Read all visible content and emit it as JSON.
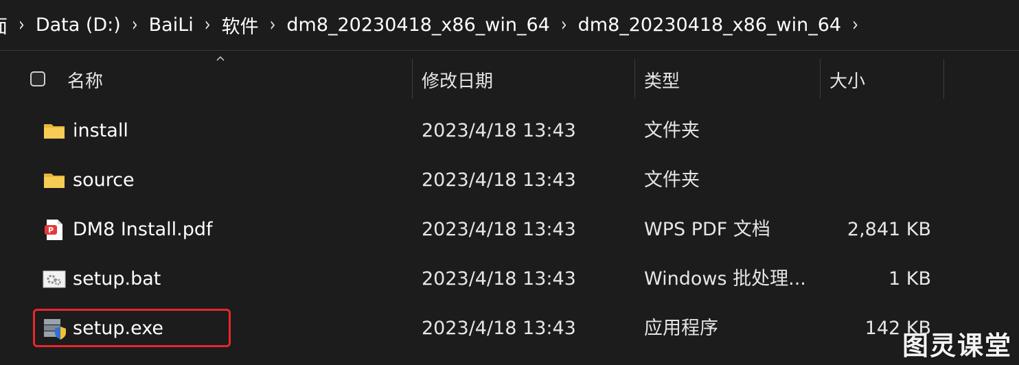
{
  "breadcrumb": {
    "items": [
      "Data (D:)",
      "BaiLi",
      "软件",
      "dm8_20230418_x86_win_64",
      "dm8_20230418_x86_win_64"
    ],
    "first_fragment": "面"
  },
  "columns": {
    "name": "名称",
    "date": "修改日期",
    "type": "类型",
    "size": "大小"
  },
  "files": [
    {
      "name": "install",
      "date": "2023/4/18 13:43",
      "type": "文件夹",
      "size": "",
      "icon": "folder-icon"
    },
    {
      "name": "source",
      "date": "2023/4/18 13:43",
      "type": "文件夹",
      "size": "",
      "icon": "folder-icon"
    },
    {
      "name": "DM8 Install.pdf",
      "date": "2023/4/18 13:43",
      "type": "WPS PDF 文档",
      "size": "2,841 KB",
      "icon": "pdf-icon"
    },
    {
      "name": "setup.bat",
      "date": "2023/4/18 13:43",
      "type": "Windows 批处理...",
      "size": "1 KB",
      "icon": "batch-file-icon"
    },
    {
      "name": "setup.exe",
      "date": "2023/4/18 13:43",
      "type": "应用程序",
      "size": "142 KB",
      "icon": "installer-icon"
    }
  ],
  "watermark": "图灵课堂",
  "colors": {
    "background": "#1c1c1c",
    "highlight": "#e8262b",
    "folder": "#f4c542"
  }
}
